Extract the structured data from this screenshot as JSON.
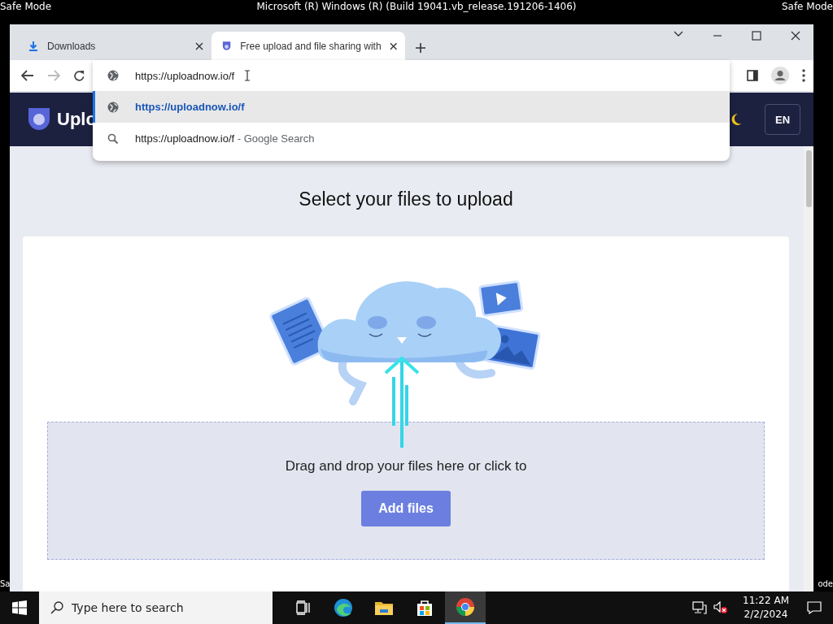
{
  "desktop": {
    "top_left": "Safe Mode",
    "title": "Microsoft (R) Windows (R) (Build 19041.vb_release.191206-1406)",
    "top_right": "Safe Mode",
    "bottom_left": "Sa",
    "bottom_right": "ode"
  },
  "browser": {
    "tabs": [
      {
        "kind": "download",
        "label": "Downloads",
        "selected": false
      },
      {
        "kind": "site",
        "label": "Free upload and file sharing with",
        "selected": true
      }
    ],
    "address": {
      "value": "https://uploadnow.io/f"
    },
    "suggestions": [
      {
        "kind": "url",
        "text": "https://uploadnow.io/f",
        "selected": true
      },
      {
        "kind": "search",
        "text": "https://uploadnow.io/f",
        "suffix": "- Google Search",
        "selected": false
      }
    ]
  },
  "page": {
    "logo": "Uplo",
    "language": "EN",
    "heading": "Select your files to upload",
    "drop_text": "Drag and drop your files here or click to",
    "button": "Add files"
  },
  "taskbar": {
    "search_placeholder": "Type here to search",
    "apps": [
      {
        "kind": "taskview",
        "selected": false
      },
      {
        "kind": "edge",
        "selected": false
      },
      {
        "kind": "explorer",
        "selected": false
      },
      {
        "kind": "store",
        "selected": false
      },
      {
        "kind": "chrome",
        "selected": true
      }
    ],
    "time": "11:22 AM",
    "date": "2/2/2024"
  }
}
